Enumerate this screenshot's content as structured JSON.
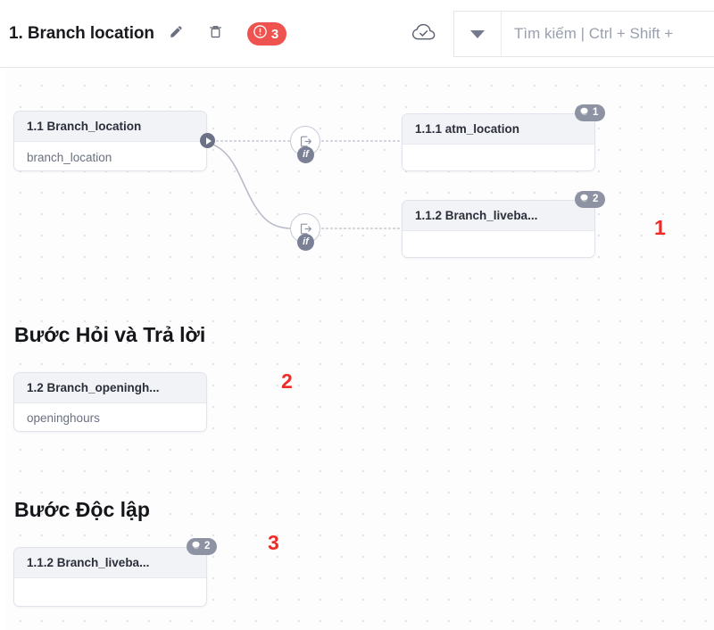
{
  "header": {
    "title": "1. Branch location",
    "edit_icon": "pencil-icon",
    "delete_icon": "trash-icon",
    "error_badge": {
      "icon": "error-circle-icon",
      "count": "3",
      "color": "#ef5350"
    },
    "cloud_status_icon": "cloud-check-icon",
    "search": {
      "dropdown_icon": "chevron-down-icon",
      "placeholder": "Tìm kiếm | Ctrl + Shift +",
      "value": ""
    }
  },
  "canvas": {
    "sections": [
      {
        "title": "Bước Hỏi và Trả lời"
      },
      {
        "title": "Bước Độc lập"
      }
    ],
    "nodes": [
      {
        "id": "node-branch-location",
        "head": "1.1 Branch_location",
        "body": "branch_location",
        "has_port": true,
        "badge": null
      },
      {
        "id": "node-atm-location",
        "head": "1.1.1 atm_location",
        "body": "",
        "has_port": false,
        "badge": {
          "icon": "chat-icon",
          "count": "1"
        }
      },
      {
        "id": "node-branch-liveba-1",
        "head": "1.1.2 Branch_liveba...",
        "body": "",
        "has_port": false,
        "badge": {
          "icon": "chat-icon",
          "count": "2"
        }
      },
      {
        "id": "node-branch-openingh",
        "head": "1.2 Branch_openingh...",
        "body": "openinghours",
        "has_port": false,
        "badge": null
      },
      {
        "id": "node-branch-liveba-2",
        "head": "1.1.2 Branch_liveba...",
        "body": "",
        "has_port": false,
        "badge": {
          "icon": "chat-icon",
          "count": "2"
        }
      }
    ],
    "connectors": [
      {
        "id": "if-connector-top",
        "label": "if",
        "icon": "flow-exit-icon"
      },
      {
        "id": "if-connector-bottom",
        "label": "if",
        "icon": "flow-exit-icon"
      }
    ],
    "annotations": [
      {
        "label": "1",
        "color": "#ee2b26"
      },
      {
        "label": "2",
        "color": "#ee2b26"
      },
      {
        "label": "3",
        "color": "#ee2b26"
      }
    ]
  }
}
